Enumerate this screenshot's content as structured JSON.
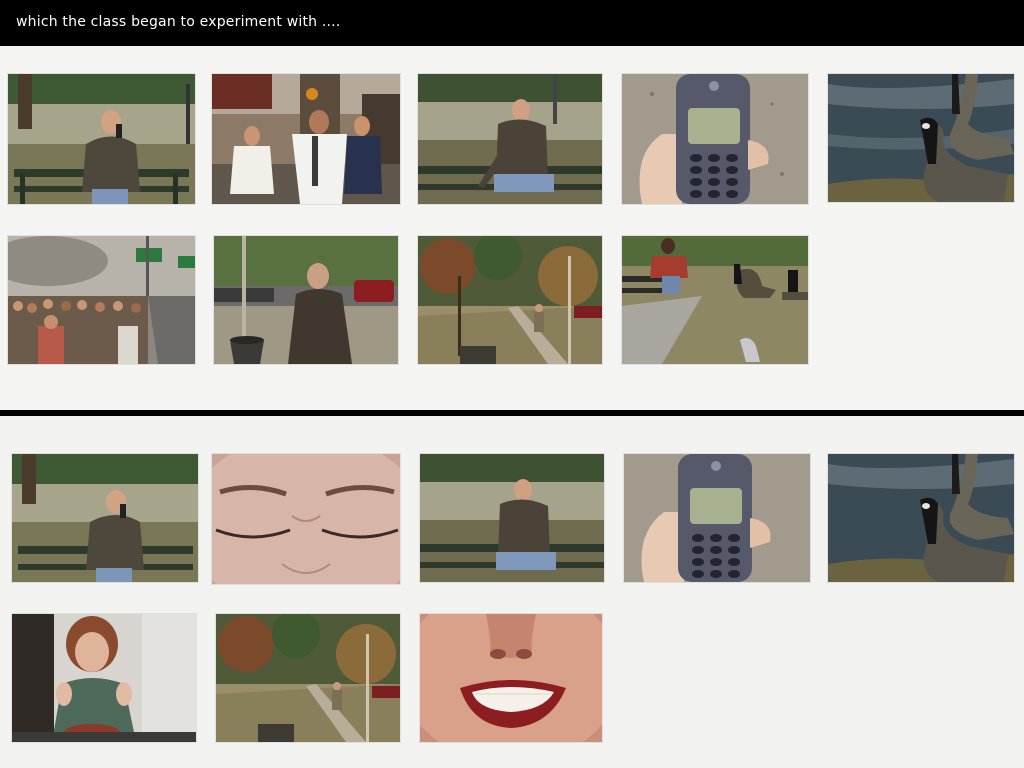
{
  "title": "which the class began to experiment with ....",
  "colors": {
    "background": "#000000",
    "panel": "#f4f4f2",
    "title_text": "#ffffff"
  },
  "panels": [
    {
      "name": "top-storyboard",
      "frames": [
        {
          "scene": "man-on-phone-bench-park"
        },
        {
          "scene": "men-running-street"
        },
        {
          "scene": "man-on-bench-reaching"
        },
        {
          "scene": "hand-holding-cellphone"
        },
        {
          "scene": "geese-by-water"
        },
        {
          "scene": "crowd-fleeing-smoke-highway"
        },
        {
          "scene": "man-by-trash-can"
        },
        {
          "scene": "autumn-trees-person-walking"
        },
        {
          "scene": "person-on-bench-feeding-geese"
        }
      ]
    },
    {
      "name": "bottom-storyboard",
      "frames": [
        {
          "scene": "man-on-phone-bench-park"
        },
        {
          "scene": "closeup-eyes-squinting"
        },
        {
          "scene": "man-on-bench-reaching"
        },
        {
          "scene": "hand-holding-cellphone"
        },
        {
          "scene": "geese-by-water"
        },
        {
          "scene": "woman-laughing-with-cake"
        },
        {
          "scene": "autumn-trees-person-walking"
        },
        {
          "scene": "closeup-smiling-mouth"
        }
      ]
    }
  ]
}
